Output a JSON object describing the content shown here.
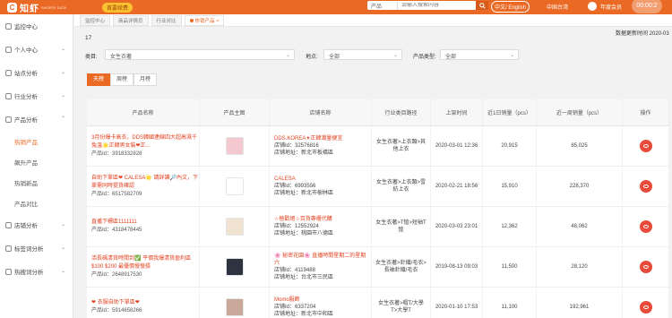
{
  "colors": {
    "brand": "#ea6a25",
    "accent_red": "#e84b3a",
    "link_red": "#e2411f"
  },
  "header": {
    "logo_text": "知虾",
    "logo_sub": "SHOPEE DATA",
    "vip_label": "首要续费",
    "search_category": "产品",
    "search_placeholder": "请输入搜索内容",
    "lang_label": "中文/ English",
    "region_label": "中国台湾",
    "member_label": "年度会员",
    "timer_text": "00:00:2"
  },
  "sidebar": {
    "items": [
      {
        "label": "监控中心",
        "icon": "monitor-icon"
      },
      {
        "label": "个人中心",
        "icon": "user-icon"
      },
      {
        "label": "站点分析",
        "icon": "globe-icon"
      },
      {
        "label": "行业分析",
        "icon": "chart-icon"
      },
      {
        "label": "产品分析",
        "icon": "box-icon"
      }
    ],
    "sub_items": [
      "热销产品",
      "飙升产品",
      "热销新品",
      "产品对比"
    ],
    "items_after": [
      {
        "label": "店铺分析",
        "icon": "store-icon"
      },
      {
        "label": "标签词分析",
        "icon": "tag-icon"
      },
      {
        "label": "热搜词分析",
        "icon": "fire-icon"
      }
    ]
  },
  "tabs": [
    "监控中心",
    "商品详情页",
    "行业对比",
    "热销产品"
  ],
  "filters": {
    "count": "17",
    "update_time": "数据更新时间 2020-03",
    "category_label": "类目:",
    "category_value": "女生衣著",
    "location_label": "地点:",
    "location_value": "全部",
    "type_label": "产品类型:",
    "type_value": "全部"
  },
  "range_tabs": [
    "天榜",
    "周榜",
    "月榜"
  ],
  "table": {
    "headers": [
      "产品名称",
      "产品主图",
      "店铺名称",
      "行业类目路径",
      "上架时间",
      "近1日销量（pcs）",
      "近一周销量（pcs）",
      "操作"
    ],
    "rows": [
      {
        "name": "3月份爆卡高衣，DDS韓國連線四大超高濕千兔溫🌟正韓男女裝❤正...",
        "pid": "产品Id：3918332828",
        "store": "DDS.KOREA✦正韓潮量便宜",
        "store_id": "店铺Id：32576816",
        "store_addr": "店铺地址：新北市板橋區",
        "category": "女生衣著>上衣類>其他上衣",
        "time": "2020-03-01 12:36",
        "day_sales": "20,915",
        "week_sales": "85,025",
        "thumb_color": "#f3c9cf"
      },
      {
        "name": "自助下單區❤ CALESA🌟 請詳讀🔎內文，下單需同時提貨確認",
        "pid": "产品Id：6517582709",
        "store": "CALESA",
        "store_id": "店铺Id：6993556",
        "store_addr": "店铺地址：新北市樹林區",
        "category": "女生衣著>上衣類>雪紡上衣",
        "time": "2020-02-21 18:56",
        "day_sales": "15,910",
        "week_sales": "228,370",
        "thumb_color": "#ffffff"
      },
      {
        "name": "直播下標區1111111",
        "pid": "产品Id：4318478445",
        "store": "☆極歡絕☆百貨專櫃代購",
        "store_id": "店铺Id：12552924",
        "store_addr": "店铺地址：桃園市八德區",
        "category": "女生衣著>T恤>短袖T恤",
        "time": "2020-03-03 23:01",
        "day_sales": "12,362",
        "week_sales": "48,062",
        "thumb_color": "#f0e3d2"
      },
      {
        "name": "活長碼清貨時間到✅ 平價我爆清貨盈利區$100 $200 最優價慢慢摃",
        "pid": "产品Id：2648917530",
        "store": "🌸 秘密花園🌸 直播時間星期二的星期六",
        "store_id": "店铺Id：4119488",
        "store_addr": "店铺地址：台北市三民區",
        "category": "女生衣著>針織/毛衣>長袖針織/毛衣",
        "time": "2019-08-13 09:03",
        "day_sales": "11,500",
        "week_sales": "28,120",
        "thumb_color": "#2d3440"
      },
      {
        "name": "❤ 衣服自助下單區❤",
        "pid": "产品Id：5914658266",
        "store": "Momo服飾",
        "store_id": "店铺Id：6337204",
        "store_addr": "店铺地址：新北市中和區",
        "category": "女生衣著>帽T/大學T>大學T",
        "time": "2020-01-10 17:53",
        "day_sales": "11,100",
        "week_sales": "192,961",
        "thumb_color": "#c9a99a"
      }
    ]
  }
}
